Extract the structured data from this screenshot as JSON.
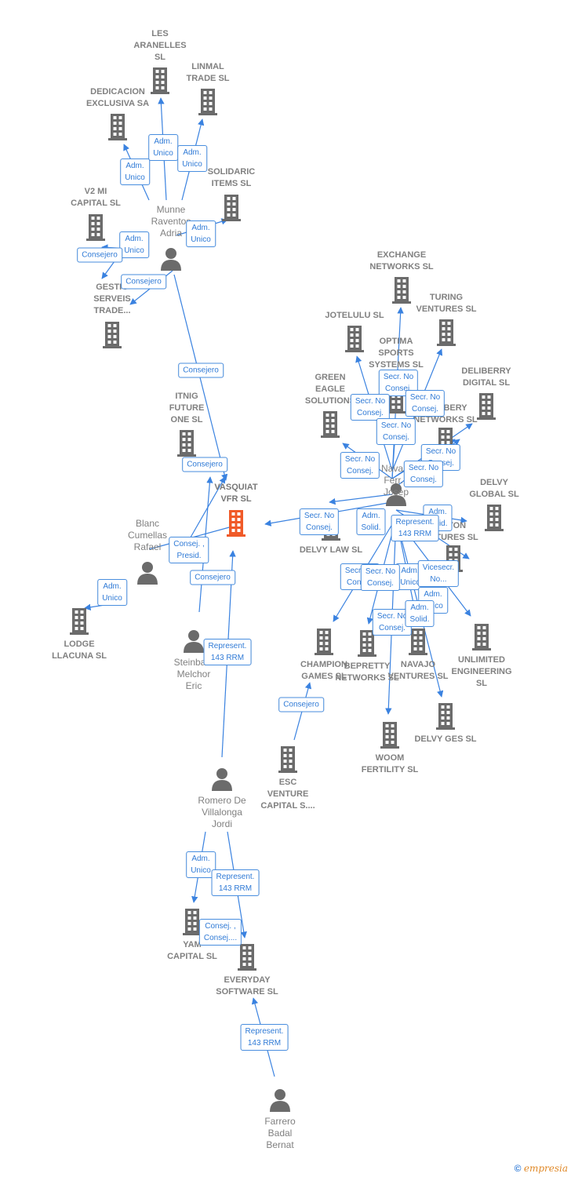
{
  "colors": {
    "edge": "#3a82e0",
    "company": "#6b6b6b",
    "main_company": "#f05a28",
    "person": "#6b6b6b"
  },
  "companies": [
    {
      "name": "LES\nARANELLES\nSL"
    },
    {
      "name": "LINMAL\nTRADE  SL"
    },
    {
      "name": "DEDICACION\nEXCLUSIVA SA"
    },
    {
      "name": "SOLIDARIC\nITEMS  SL"
    },
    {
      "name": "V2 MI\nCAPITAL  SL"
    },
    {
      "name": "GESTIO\nSERVEIS\nTRADE..."
    },
    {
      "name": "EXCHANGE\nNETWORKS SL"
    },
    {
      "name": "TURING\nVENTURES  SL"
    },
    {
      "name": "JOTELULU  SL"
    },
    {
      "name": "OPTIMA\nSPORTS\nSYSTEMS  SL"
    },
    {
      "name": "DELIBERRY\nDIGITAL  SL"
    },
    {
      "name": "GREEN\nEAGLE\nSOLUTIONS"
    },
    {
      "name": "DELIBERY\nNETWORKS  SL"
    },
    {
      "name": "ITNIG\nFUTURE\nONE  SL"
    },
    {
      "name": "VASQUIAT\nVFR  SL",
      "main": true
    },
    {
      "name": "DELVY LAW  SL"
    },
    {
      "name": "DELVY\nGLOBAL  SL"
    },
    {
      "name": "...TON\n...TURES  SL"
    },
    {
      "name": "LODGE\nLLACUNA  SL"
    },
    {
      "name": "CHAMPION\nGAMES  SL"
    },
    {
      "name": "BEPRETTY\nNETWORKS  SL"
    },
    {
      "name": "NAVAJO\nVENTURES  SL"
    },
    {
      "name": "UNLIMITED\nENGINEERING\nSL"
    },
    {
      "name": "DELVY GES  SL"
    },
    {
      "name": "WOOM\nFERTILITY  SL"
    },
    {
      "name": "ESC\nVENTURE\nCAPITAL S...."
    },
    {
      "name": "YAM\nCAPITAL  SL"
    },
    {
      "name": "EVERYDAY\nSOFTWARE  SL"
    }
  ],
  "persons": [
    {
      "name": "Munne\nRaventos\nAdria"
    },
    {
      "name": "Blanc\nCumellas\nRafael"
    },
    {
      "name": "Steinba...\nMelchor\nEric"
    },
    {
      "name": "Romero De\nVillalonga\nJordi"
    },
    {
      "name": "Farrero\nBadal\nBernat"
    },
    {
      "name": "Nava...\nFerr...\nJosep"
    }
  ],
  "relations": [
    "Adm.\nUnico",
    "Adm.\nUnico",
    "Adm.\nUnico",
    "Adm.\nUnico",
    "Adm.\nUnico",
    "Consejero",
    "Consejero",
    "Consejero",
    "Consejero",
    "Consej. ,\nPresid.",
    "Consejero",
    "Adm.\nUnico",
    "Represent.\n143 RRM",
    "Consejero",
    "Adm.\nUnico",
    "Represent.\n143 RRM",
    "Consej. ,\nConsej....",
    "Represent.\n143 RRM",
    "Secr.  No\nConsej.",
    "Secr.  No\nConsej.",
    "Secr.  No\nConsej.",
    "Secr.  No\nConsej.",
    "Secr.  No\nConsej.",
    "Secr.  No\nConsej.",
    "Secr.  No\nConsej.",
    "Secr.  No\nConsej.",
    "Adm.\nSolid.",
    "Adm.\nSolid.",
    "Represent.\n143 RRM",
    "Secr.  No\nConsej.",
    "Adm.\nUnico",
    "Secr.  No\nConsej.",
    "Vicesecr.\nNo...",
    "Adm.\nUnico",
    "Secr.  No\nConsej.",
    "Adm.\nSolid."
  ],
  "footer": {
    "copyright": "©",
    "brand": "empresia"
  }
}
